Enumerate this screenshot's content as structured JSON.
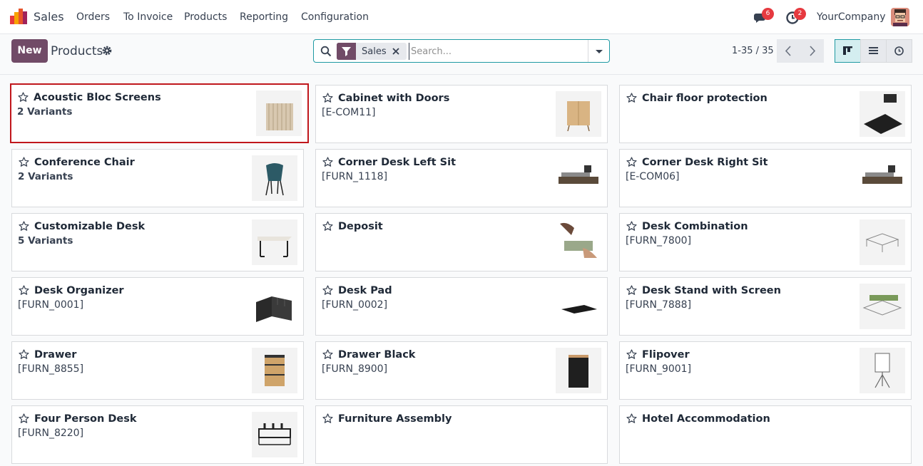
{
  "app": {
    "name": "Sales",
    "menu": [
      "Orders",
      "To Invoice",
      "Products",
      "Reporting",
      "Configuration"
    ],
    "messages_count": "6",
    "activities_count": "2",
    "company": "YourCompany"
  },
  "control": {
    "new_label": "New",
    "title": "Products",
    "search_facet": "Sales",
    "search_placeholder": "Search...",
    "pager": "1-35 / 35"
  },
  "colors": {
    "brand": "#714b67",
    "accent": "#1f9aa3",
    "selected_border": "#c0171c",
    "badge": "#e6393f"
  },
  "cards": [
    {
      "name": "Acoustic Bloc Screens",
      "sub": "2 Variants",
      "variants": true,
      "selected": true,
      "image": "acoustic-screens-image"
    },
    {
      "name": "Cabinet with Doors",
      "sub": "[E-COM11]",
      "variants": false,
      "image": "cabinet-image"
    },
    {
      "name": "Chair floor protection",
      "sub": "",
      "variants": false,
      "image": "floor-protection-image"
    },
    {
      "name": "Conference Chair",
      "sub": "2 Variants",
      "variants": true,
      "image": "chair-image"
    },
    {
      "name": "Corner Desk Left Sit",
      "sub": "[FURN_1118]",
      "variants": false,
      "image": "corner-desk-image"
    },
    {
      "name": "Corner Desk Right Sit",
      "sub": "[E-COM06]",
      "variants": false,
      "image": "corner-desk-image"
    },
    {
      "name": "Customizable Desk",
      "sub": "5 Variants",
      "variants": true,
      "image": "desk-image"
    },
    {
      "name": "Deposit",
      "sub": "",
      "variants": false,
      "image": "money-image"
    },
    {
      "name": "Desk Combination",
      "sub": "[FURN_7800]",
      "variants": false,
      "image": "desk-combination-image"
    },
    {
      "name": "Desk Organizer",
      "sub": "[FURN_0001]",
      "variants": false,
      "image": "organizer-image"
    },
    {
      "name": "Desk Pad",
      "sub": "[FURN_0002]",
      "variants": false,
      "image": "desk-pad-image"
    },
    {
      "name": "Desk Stand with Screen",
      "sub": "[FURN_7888]",
      "variants": false,
      "image": "desk-stand-image"
    },
    {
      "name": "Drawer",
      "sub": "[FURN_8855]",
      "variants": false,
      "image": "drawer-image"
    },
    {
      "name": "Drawer Black",
      "sub": "[FURN_8900]",
      "variants": false,
      "image": "drawer-black-image"
    },
    {
      "name": "Flipover",
      "sub": "[FURN_9001]",
      "variants": false,
      "image": "flipover-image"
    },
    {
      "name": "Four Person Desk",
      "sub": "[FURN_8220]",
      "variants": false,
      "image": "four-desk-image"
    },
    {
      "name": "Furniture Assembly",
      "sub": "",
      "variants": false,
      "image": ""
    },
    {
      "name": "Hotel Accommodation",
      "sub": "",
      "variants": false,
      "image": ""
    }
  ]
}
